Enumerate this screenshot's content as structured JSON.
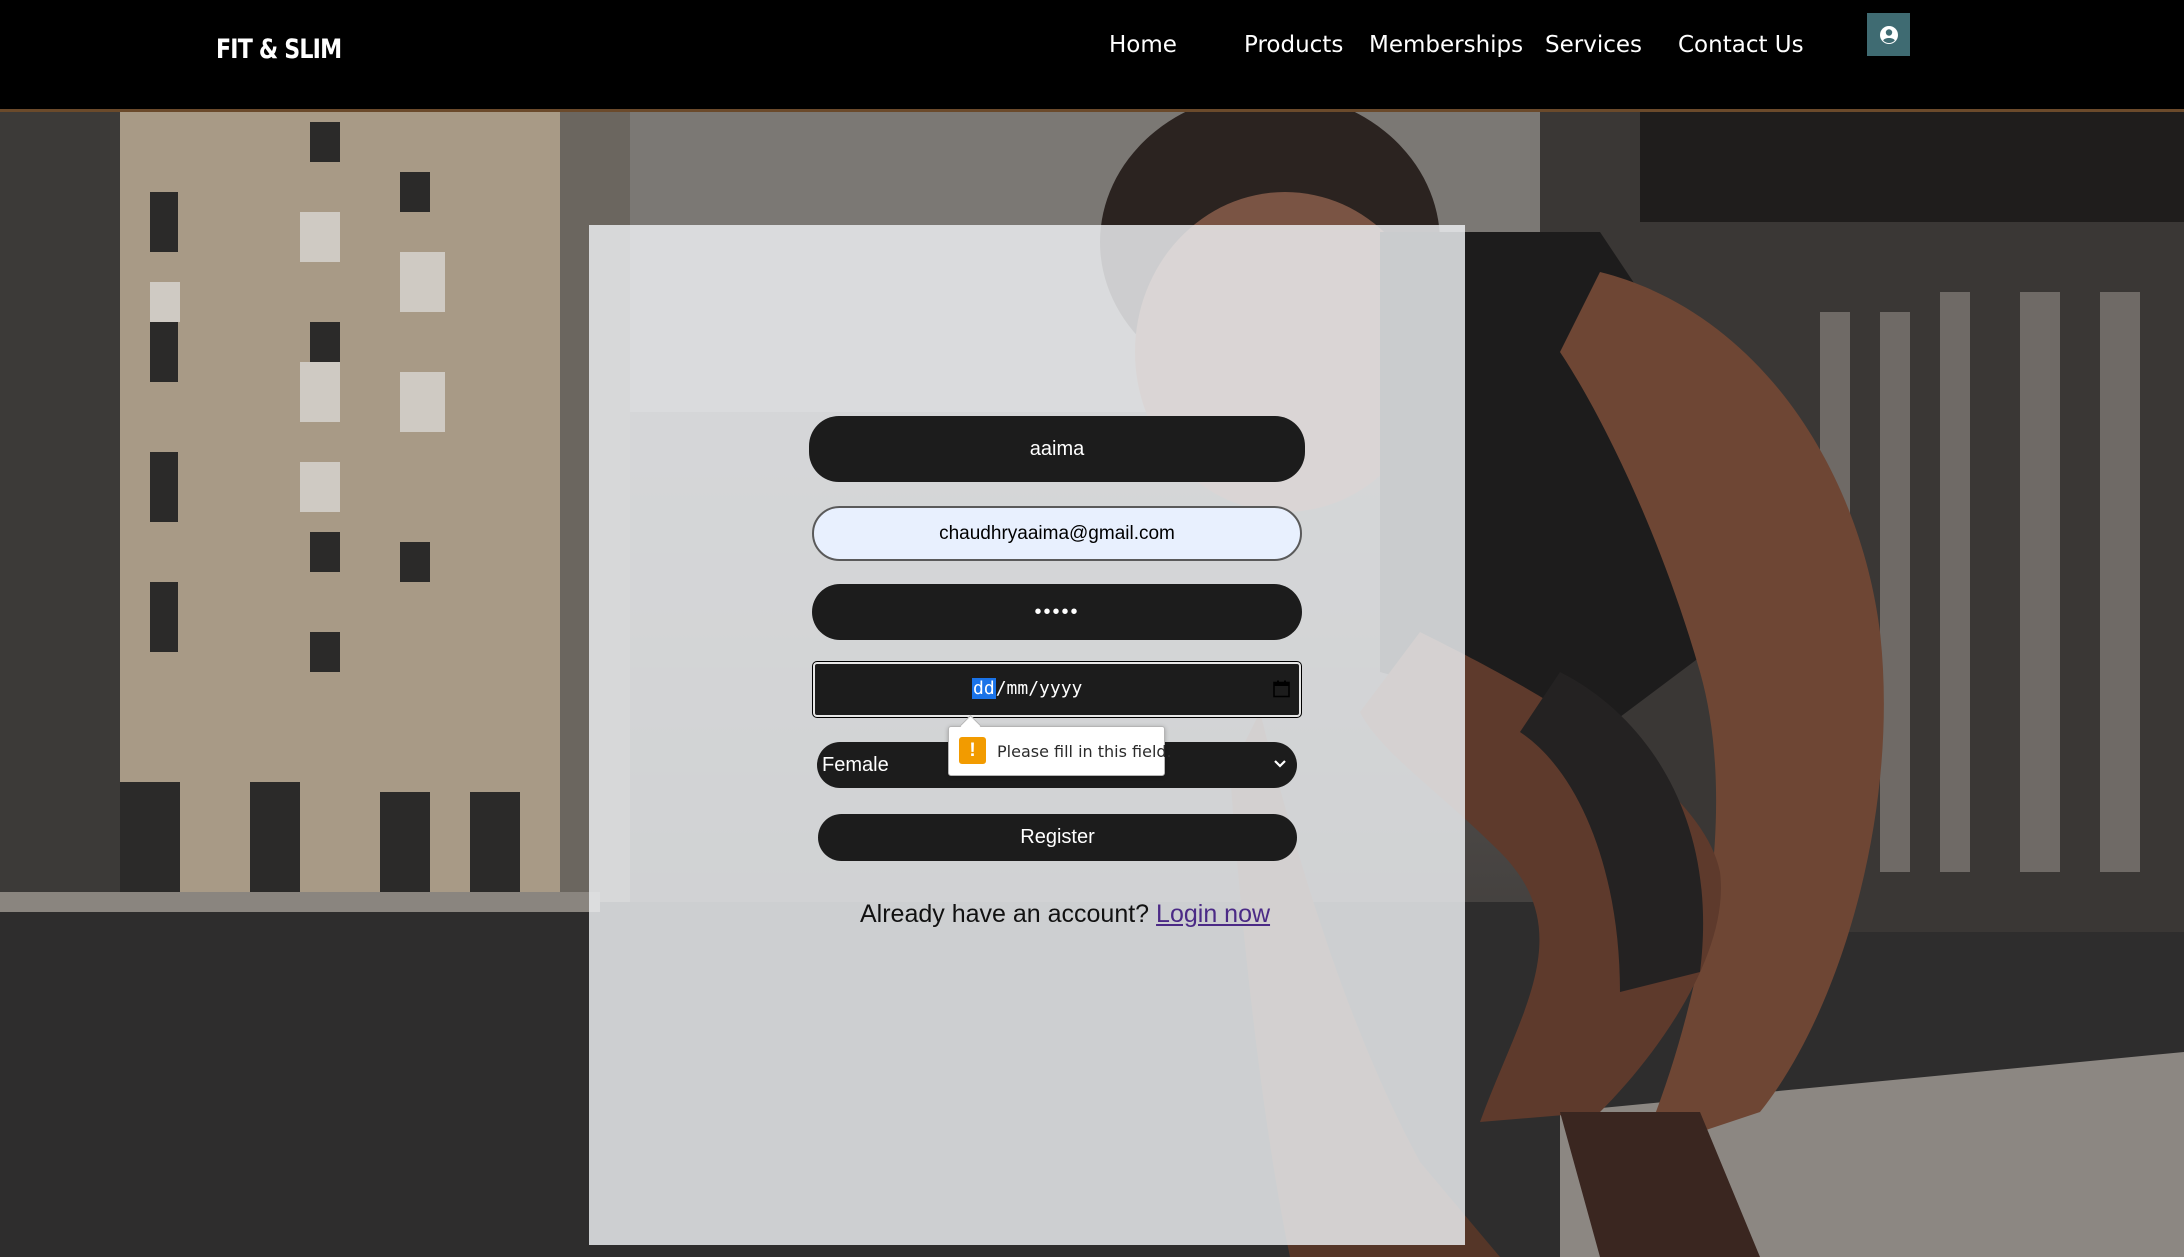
{
  "brand": {
    "logo_text": "FIT & SLIM"
  },
  "nav": {
    "items": [
      {
        "label": "Home"
      },
      {
        "label": "Products"
      },
      {
        "label": "Memberships"
      },
      {
        "label": "Services"
      },
      {
        "label": "Contact Us"
      }
    ],
    "account_icon": "user-circle-icon",
    "account_button_color": "#3f6b72"
  },
  "form": {
    "name_value": "aaima",
    "email_value": "chaudhryaaima@gmail.com",
    "password_value": "•••••",
    "dob": {
      "day_placeholder": "dd",
      "rest_placeholder": "/mm/yyyy"
    },
    "gender_value": "Female",
    "register_label": "Register",
    "login_prompt": "Already have an account?",
    "login_link": "Login now"
  },
  "validation_tooltip": {
    "icon": "warning-icon",
    "message": "Please fill in this field."
  },
  "colors": {
    "field_dark": "#1c1c1c",
    "autofill_bg": "#e8f0fe",
    "link": "#4b2a86",
    "warning": "#f29b00"
  }
}
